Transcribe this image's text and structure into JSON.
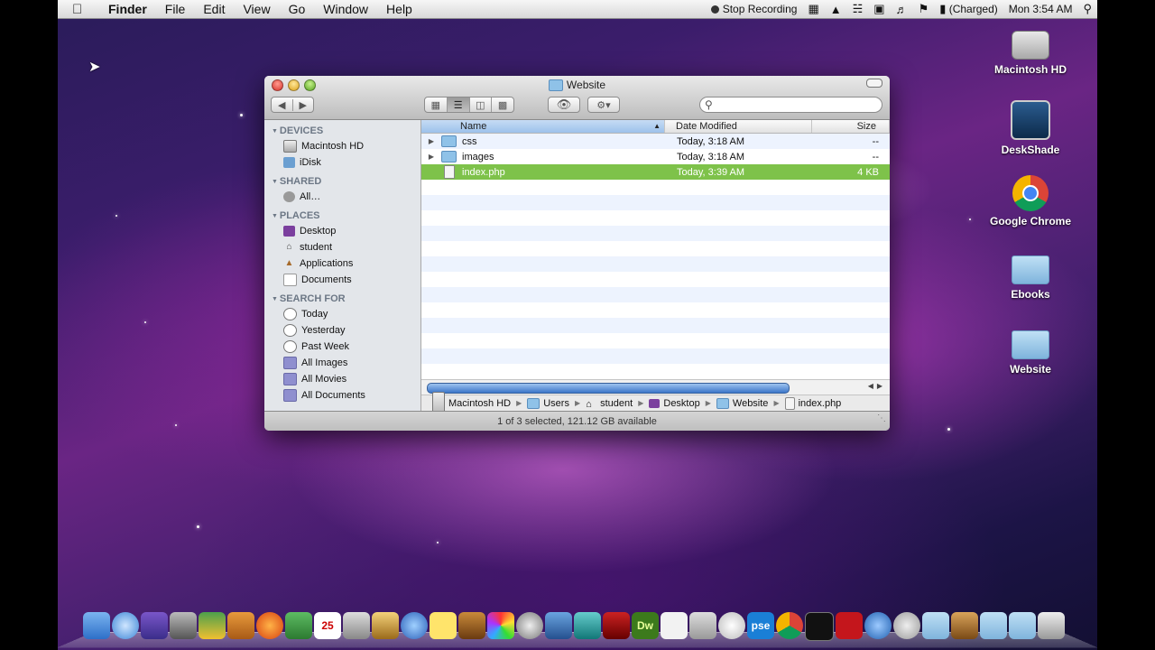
{
  "menubar": {
    "app": "Finder",
    "items": [
      "File",
      "Edit",
      "View",
      "Go",
      "Window",
      "Help"
    ],
    "recording": "Stop Recording",
    "battery": "(Charged)",
    "clock": "Mon 3:54 AM"
  },
  "desktop_icons": [
    {
      "label": "Macintosh HD",
      "icon": "hard-drive-icon"
    },
    {
      "label": "DeskShade",
      "icon": "deskshade-icon"
    },
    {
      "label": "Google Chrome",
      "icon": "chrome-icon"
    },
    {
      "label": "Ebooks",
      "icon": "folder-icon"
    },
    {
      "label": "Website",
      "icon": "folder-icon"
    }
  ],
  "window": {
    "title": "Website",
    "search_placeholder": "",
    "sidebar": {
      "devices_label": "DEVICES",
      "devices": [
        "Macintosh HD",
        "iDisk"
      ],
      "shared_label": "SHARED",
      "shared": [
        "All…"
      ],
      "places_label": "PLACES",
      "places": [
        "Desktop",
        "student",
        "Applications",
        "Documents"
      ],
      "search_label": "SEARCH FOR",
      "search_for": [
        "Today",
        "Yesterday",
        "Past Week",
        "All Images",
        "All Movies",
        "All Documents"
      ]
    },
    "columns": {
      "name": "Name",
      "date": "Date Modified",
      "size": "Size"
    },
    "rows": [
      {
        "name": "css",
        "date": "Today, 3:18 AM",
        "size": "--",
        "kind": "folder",
        "selected": false
      },
      {
        "name": "images",
        "date": "Today, 3:18 AM",
        "size": "--",
        "kind": "folder",
        "selected": false
      },
      {
        "name": "index.php",
        "date": "Today, 3:39 AM",
        "size": "4 KB",
        "kind": "file",
        "selected": true
      }
    ],
    "path": [
      "Macintosh HD",
      "Users",
      "student",
      "Desktop",
      "Website",
      "index.php"
    ],
    "status": "1 of 3 selected, 121.12 GB available"
  },
  "dock": {
    "labels": {
      "dreamweaver": "Dw",
      "photoshop_elements": "pse"
    }
  },
  "colors": {
    "selection": "#7ec24a",
    "menubar": "#e8e8e8"
  }
}
